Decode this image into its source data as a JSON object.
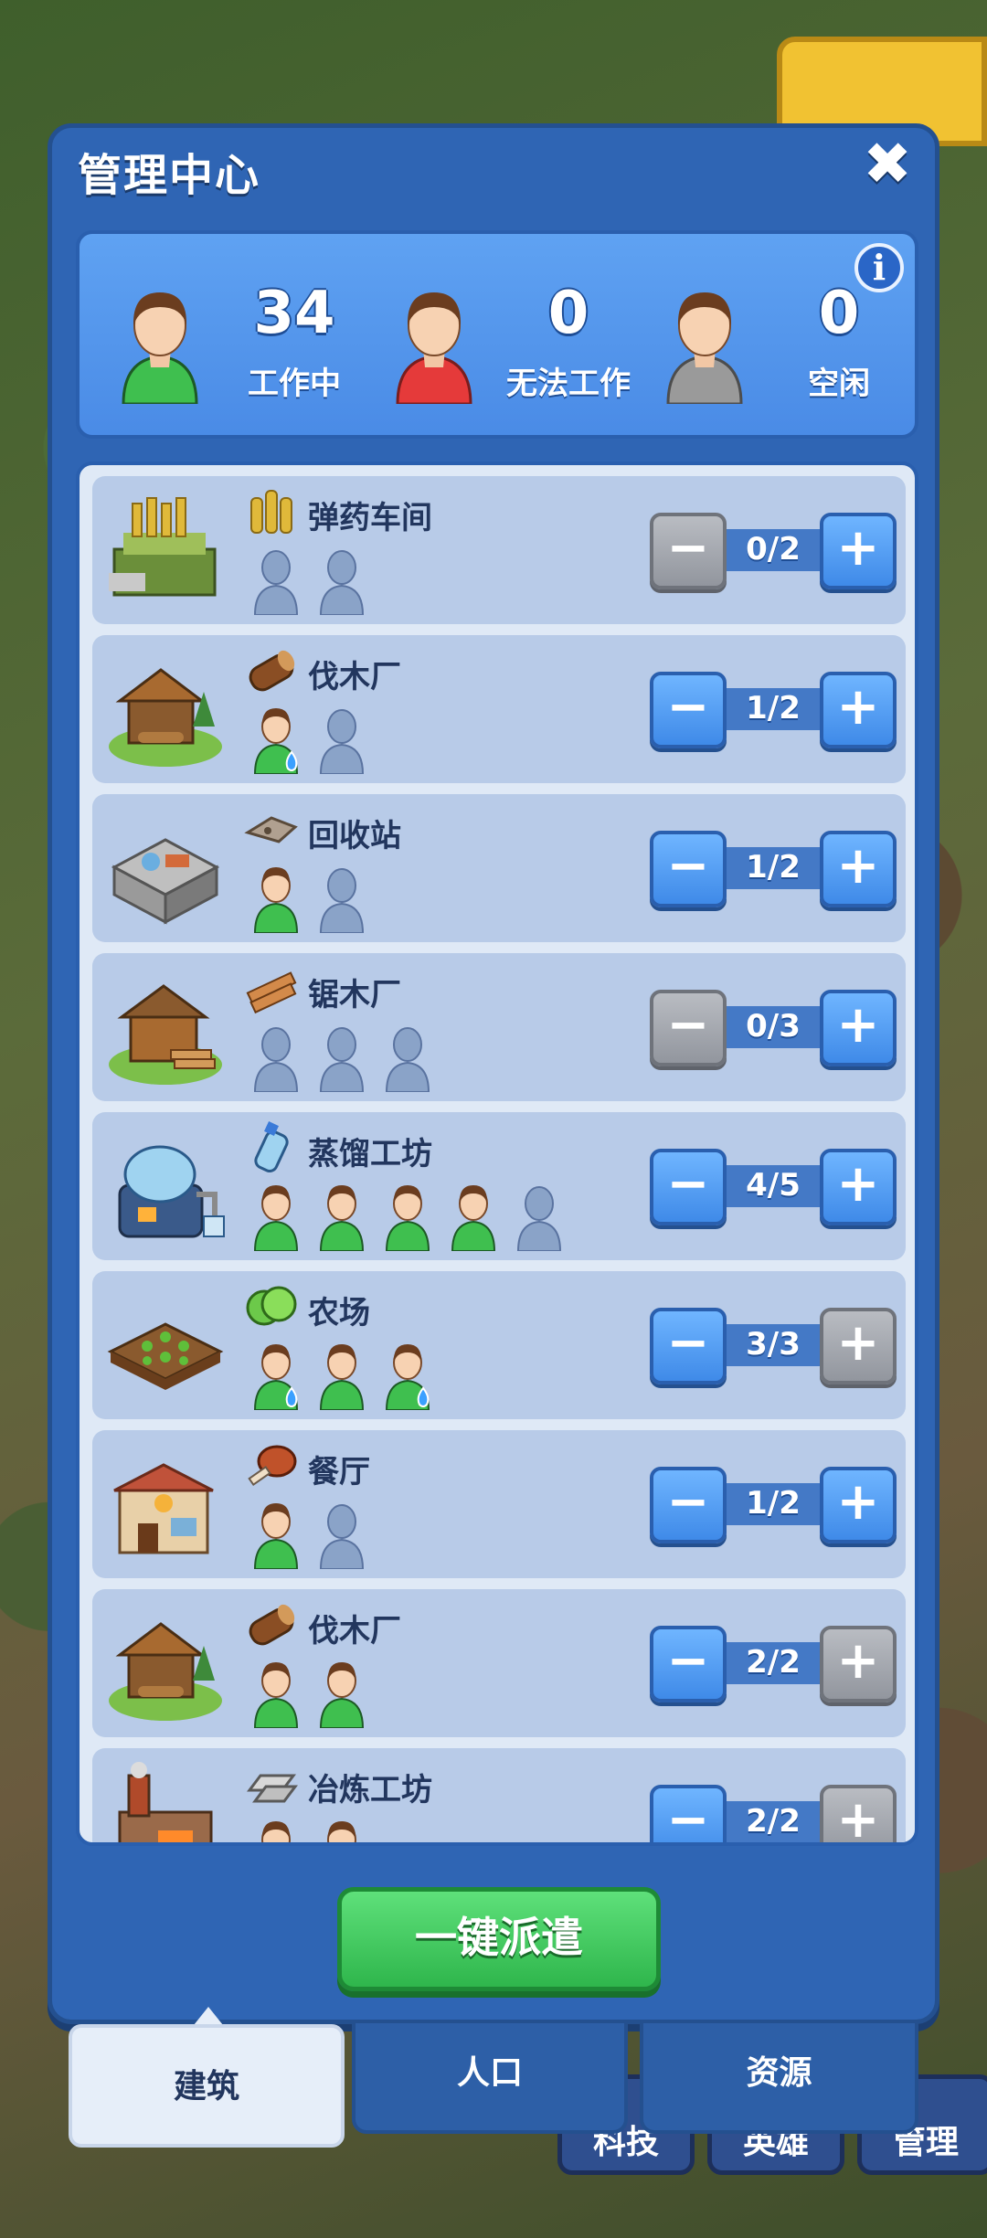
{
  "dialog": {
    "title": "管理中心",
    "close_icon": "close-icon"
  },
  "summary": {
    "working": {
      "count": "34",
      "label": "工作中",
      "color": "#3fbf4f"
    },
    "unable": {
      "count": "0",
      "label": "无法工作",
      "color": "#e53a3a"
    },
    "idle": {
      "count": "0",
      "label": "空闲",
      "color": "#9a9a9a"
    }
  },
  "buildings": [
    {
      "name": "弹药车间",
      "resource_icon": "ammo-icon",
      "count": "0/2",
      "workers": [
        "empty",
        "empty"
      ],
      "minus_enabled": false,
      "plus_enabled": true
    },
    {
      "name": "伐木厂",
      "resource_icon": "log-icon",
      "count": "1/2",
      "workers": [
        "thirsty",
        "empty"
      ],
      "minus_enabled": true,
      "plus_enabled": true
    },
    {
      "name": "回收站",
      "resource_icon": "scrap-icon",
      "count": "1/2",
      "workers": [
        "worker",
        "empty"
      ],
      "minus_enabled": true,
      "plus_enabled": true
    },
    {
      "name": "锯木厂",
      "resource_icon": "planks-icon",
      "count": "0/3",
      "workers": [
        "empty",
        "empty",
        "empty"
      ],
      "minus_enabled": false,
      "plus_enabled": true
    },
    {
      "name": "蒸馏工坊",
      "resource_icon": "water-bottle-icon",
      "count": "4/5",
      "workers": [
        "worker",
        "worker",
        "worker",
        "worker",
        "empty"
      ],
      "minus_enabled": true,
      "plus_enabled": true
    },
    {
      "name": "农场",
      "resource_icon": "lettuce-icon",
      "count": "3/3",
      "workers": [
        "thirsty",
        "worker",
        "thirsty"
      ],
      "minus_enabled": true,
      "plus_enabled": false
    },
    {
      "name": "餐厅",
      "resource_icon": "meat-icon",
      "count": "1/2",
      "workers": [
        "worker",
        "empty"
      ],
      "minus_enabled": true,
      "plus_enabled": true
    },
    {
      "name": "伐木厂",
      "resource_icon": "log-icon",
      "count": "2/2",
      "workers": [
        "worker",
        "worker"
      ],
      "minus_enabled": true,
      "plus_enabled": false
    },
    {
      "name": "冶炼工坊",
      "resource_icon": "ingot-icon",
      "count": "2/2",
      "workers": [
        "worker",
        "worker"
      ],
      "minus_enabled": true,
      "plus_enabled": false
    }
  ],
  "dispatch_label": "一键派遣",
  "tabs": [
    {
      "label": "建筑",
      "active": true
    },
    {
      "label": "人口",
      "active": false
    },
    {
      "label": "资源",
      "active": false
    }
  ],
  "background": {
    "bottom_buttons": [
      "科技",
      "英雄",
      "管理"
    ]
  }
}
